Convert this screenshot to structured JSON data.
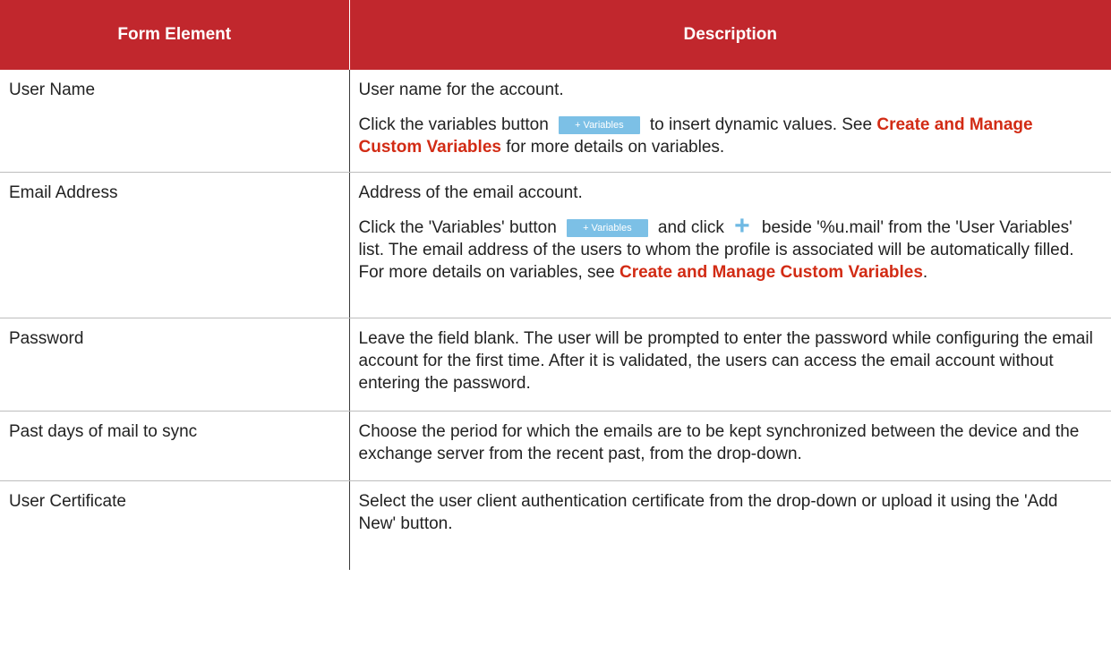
{
  "table": {
    "header": {
      "form_element": "Form Element",
      "description": "Description"
    },
    "rows": [
      {
        "element": "User Name",
        "p1": "User name for the account.",
        "p2_a": "Click the variables button",
        "variables_button": "+ Variables",
        "p2_b": "to insert dynamic values. See",
        "link": "Create and Manage Custom Variables",
        "p2_c": "for more details on variables."
      },
      {
        "element": "Email Address",
        "p1": "Address of the email account.",
        "p2_a": "Click the 'Variables' button",
        "variables_button": "+ Variables",
        "p2_b": "and click",
        "plus_glyph": "+",
        "p2_c": "beside '%u.mail' from the 'User Variables' list. The email address of the users to whom the profile is associated will be automatically filled. For more details on variables, see",
        "link": "Create and Manage Custom Variables",
        "p2_d": "."
      },
      {
        "element": "Password",
        "p1": "Leave the field blank. The user will be prompted to enter the password while configuring the email account for the first time. After it is validated, the users can access the email account without entering the password."
      },
      {
        "element": "Past days of mail to sync",
        "p1": "Choose the period for which the emails are to be kept synchronized between the device and the exchange server from the recent past, from the drop-down."
      },
      {
        "element": "User Certificate",
        "p1": "Select the user client authentication certificate from the drop-down or upload it using the 'Add New' button."
      }
    ]
  },
  "colors": {
    "header_bg": "#c1272d",
    "link": "#d22b14",
    "variables_button_bg": "#7cc0e6"
  }
}
